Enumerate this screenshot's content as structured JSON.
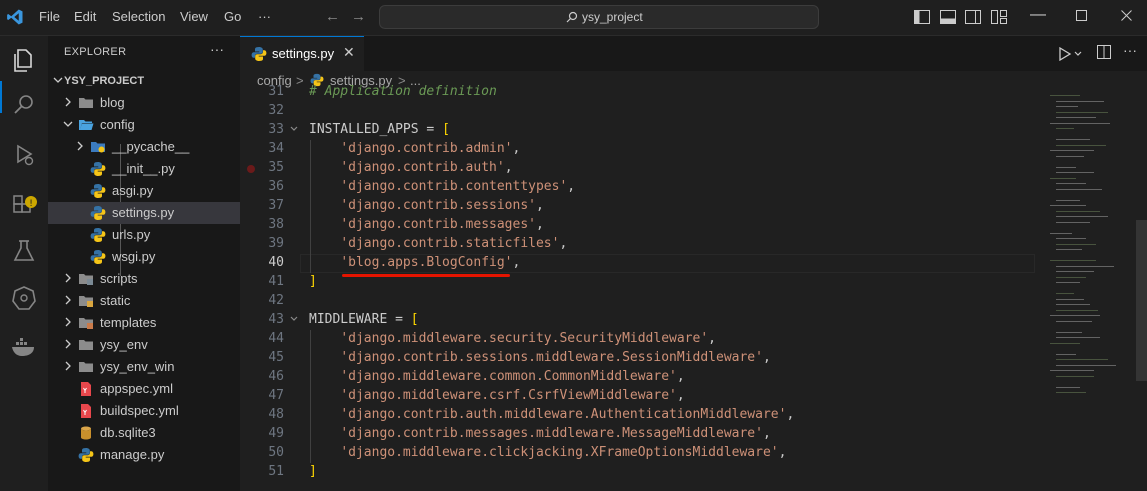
{
  "titlebar": {
    "menus": [
      "File",
      "Edit",
      "Selection",
      "View",
      "Go",
      "···"
    ],
    "search_text": "ysy_project"
  },
  "explorer": {
    "title": "EXPLORER",
    "more": "···",
    "root": "YSY_PROJECT",
    "items": [
      {
        "label": "blog",
        "type": "folder"
      },
      {
        "label": "config",
        "type": "folder-open"
      },
      {
        "label": "__pycache__",
        "type": "pycache"
      },
      {
        "label": "__init__.py",
        "type": "py"
      },
      {
        "label": "asgi.py",
        "type": "py"
      },
      {
        "label": "settings.py",
        "type": "py"
      },
      {
        "label": "urls.py",
        "type": "py"
      },
      {
        "label": "wsgi.py",
        "type": "py"
      },
      {
        "label": "scripts",
        "type": "folder"
      },
      {
        "label": "static",
        "type": "folder"
      },
      {
        "label": "templates",
        "type": "folder"
      },
      {
        "label": "ysy_env",
        "type": "folder"
      },
      {
        "label": "ysy_env_win",
        "type": "folder"
      },
      {
        "label": "appspec.yml",
        "type": "yml"
      },
      {
        "label": "buildspec.yml",
        "type": "yml"
      },
      {
        "label": "db.sqlite3",
        "type": "db"
      },
      {
        "label": "manage.py",
        "type": "py"
      }
    ]
  },
  "editor": {
    "tab_label": "settings.py",
    "breadcrumb": [
      "config",
      ">",
      "settings.py",
      ">",
      "..."
    ],
    "current_line": "40",
    "lines": [
      {
        "n": "31",
        "text": "# Application definition"
      },
      {
        "n": "32",
        "text": ""
      },
      {
        "n": "33",
        "text": "INSTALLED_APPS = ["
      },
      {
        "n": "34",
        "text": "    'django.contrib.admin',"
      },
      {
        "n": "35",
        "text": "    'django.contrib.auth',"
      },
      {
        "n": "36",
        "text": "    'django.contrib.contenttypes',"
      },
      {
        "n": "37",
        "text": "    'django.contrib.sessions',"
      },
      {
        "n": "38",
        "text": "    'django.contrib.messages',"
      },
      {
        "n": "39",
        "text": "    'django.contrib.staticfiles',"
      },
      {
        "n": "40",
        "text": "    'blog.apps.BlogConfig',"
      },
      {
        "n": "41",
        "text": "]"
      },
      {
        "n": "42",
        "text": ""
      },
      {
        "n": "43",
        "text": "MIDDLEWARE = ["
      },
      {
        "n": "44",
        "text": "    'django.middleware.security.SecurityMiddleware',"
      },
      {
        "n": "45",
        "text": "    'django.contrib.sessions.middleware.SessionMiddleware',"
      },
      {
        "n": "46",
        "text": "    'django.middleware.common.CommonMiddleware',"
      },
      {
        "n": "47",
        "text": "    'django.middleware.csrf.CsrfViewMiddleware',"
      },
      {
        "n": "48",
        "text": "    'django.contrib.auth.middleware.AuthenticationMiddleware',"
      },
      {
        "n": "49",
        "text": "    'django.contrib.messages.middleware.MessageMiddleware',"
      },
      {
        "n": "50",
        "text": "    'django.middleware.clickjacking.XFrameOptionsMiddleware',"
      },
      {
        "n": "51",
        "text": "]"
      }
    ]
  },
  "colors": {
    "accent": "#0078d4",
    "string": "#ce9178",
    "comment": "#6a9955",
    "bracket": "#ffd700",
    "annotation_underline": "#e51400"
  }
}
